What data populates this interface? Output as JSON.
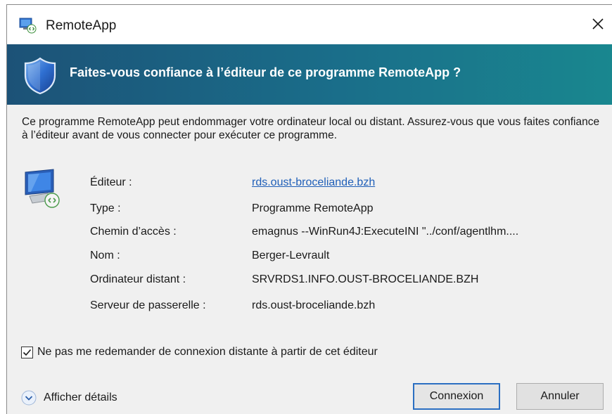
{
  "window": {
    "title": "RemoteApp",
    "close_glyph": "✕"
  },
  "banner": {
    "heading": "Faites-vous confiance à l’éditeur de ce programme RemoteApp ?",
    "icon": "shield-icon",
    "colors": {
      "start": "#1c5277",
      "end": "#19878f"
    }
  },
  "intro": {
    "text": "Ce programme RemoteApp peut endommager votre ordinateur local ou distant. Assurez-vous que vous faites confiance à l’éditeur avant de vous connecter pour exécuter ce programme."
  },
  "details": {
    "icon": "remote-computer-icon",
    "rows": [
      {
        "label": "Éditeur :",
        "value": "rds.oust-broceliande.bzh",
        "is_link": true
      },
      {
        "label": "Type :",
        "value": "Programme RemoteApp",
        "is_link": false
      },
      {
        "label": "Chemin d’accès :",
        "value": "emagnus --WinRun4J:ExecuteINI \"../conf/agentlhm....",
        "is_link": false
      },
      {
        "label": "Nom :",
        "value": "Berger-Levrault",
        "is_link": false
      },
      {
        "label": "Ordinateur distant :",
        "value": "SRVRDS1.INFO.OUST-BROCELIANDE.BZH",
        "is_link": false
      },
      {
        "label": "Serveur de passerelle :",
        "value": "rds.oust-broceliande.bzh",
        "is_link": false
      }
    ]
  },
  "checkbox": {
    "label": "Ne pas me redemander de connexion distante à partir de cet éditeur",
    "checked": true
  },
  "footer": {
    "details_label": "Afficher détails",
    "connect_label": "Connexion",
    "cancel_label": "Annuler",
    "accent_color": "#2b6fc2"
  }
}
